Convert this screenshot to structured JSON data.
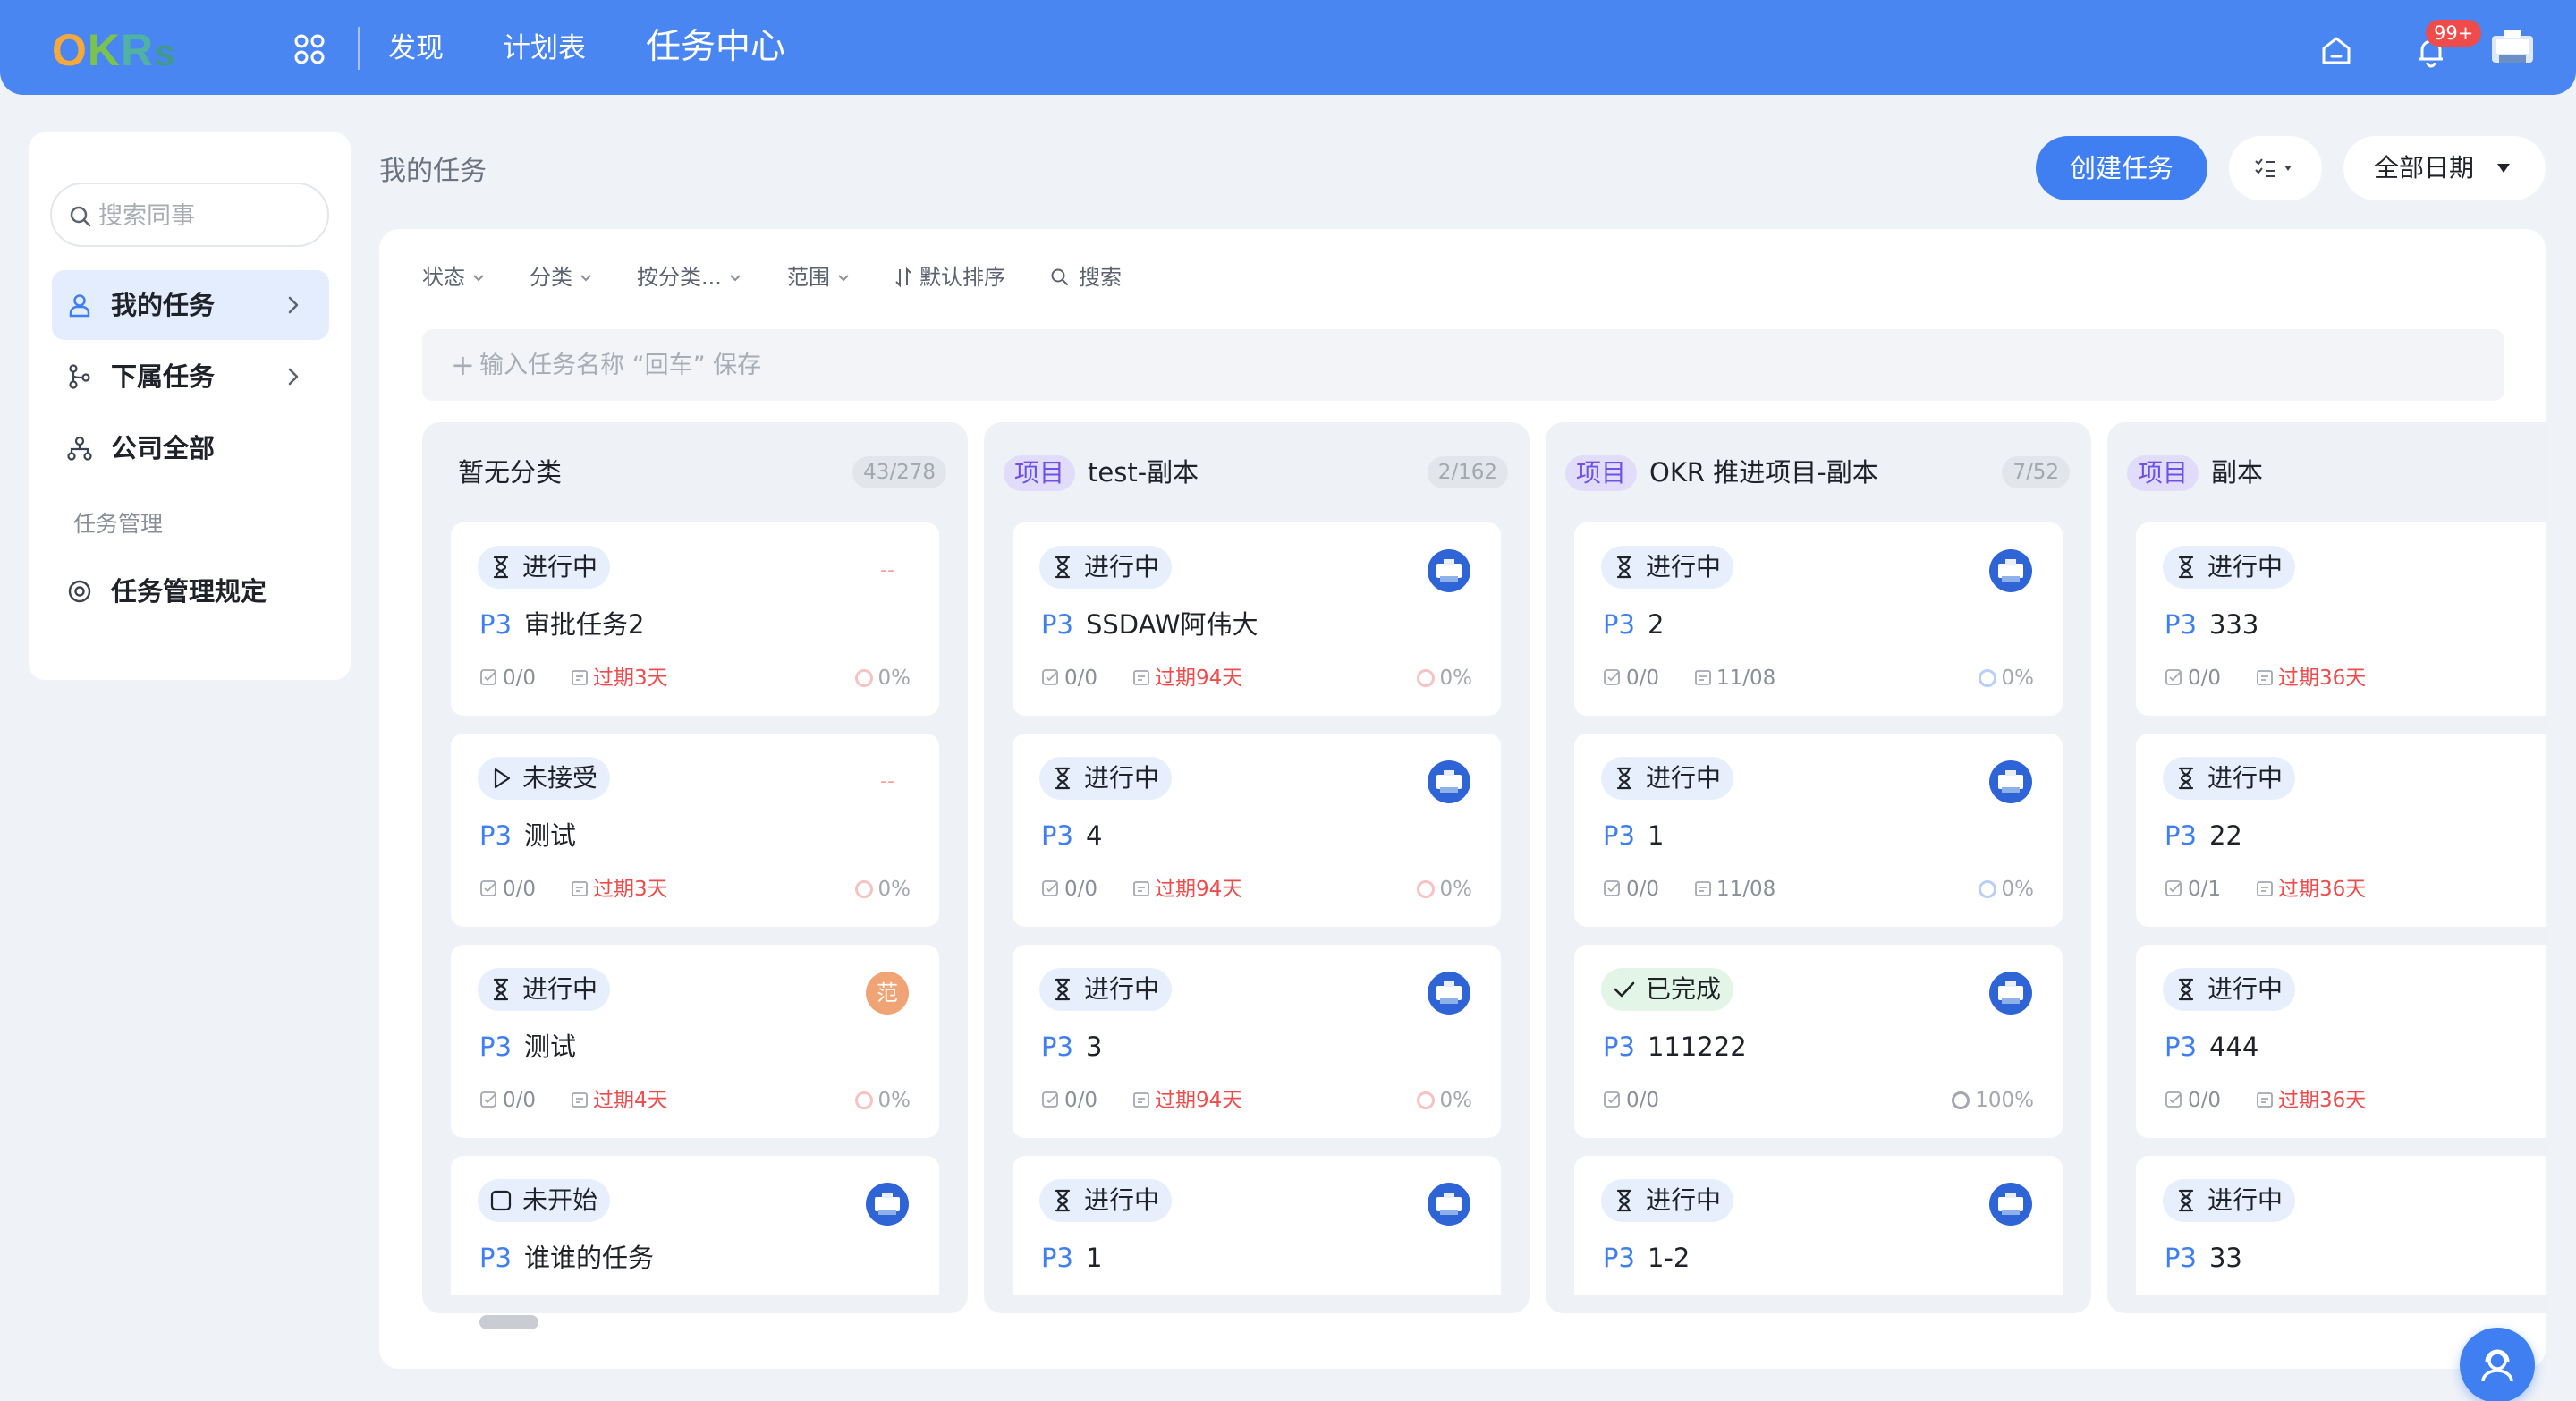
{
  "topbar": {
    "logo": {
      "o": "O",
      "k": "K",
      "r": "R",
      "s": "s"
    },
    "nav": [
      "发现",
      "计划表",
      "任务中心"
    ],
    "notification_count": "99+"
  },
  "sidebar": {
    "search_placeholder": "搜索同事",
    "items": [
      "我的任务",
      "下属任务",
      "公司全部"
    ],
    "section_label": "任务管理",
    "section_items": [
      "任务管理规定"
    ]
  },
  "main": {
    "title": "我的任务",
    "create_button": "创建任务",
    "date_filter": "全部日期",
    "filters": [
      "状态",
      "分类",
      "按分类...",
      "范围",
      "默认排序",
      "搜索"
    ],
    "quick_add_placeholder": "输入任务名称 “回车” 保存",
    "quick_add_plus": "+"
  },
  "columns": [
    {
      "tag": "",
      "name": "暂无分类",
      "count": "43/278",
      "cards": [
        {
          "status": "进行中",
          "priority": "P3",
          "title": "审批任务2",
          "subtasks": "0/0",
          "due": "过期3天",
          "progress": "0%",
          "assignee": "--"
        },
        {
          "status": "未接受",
          "priority": "P3",
          "title": "测试",
          "subtasks": "0/0",
          "due": "过期3天",
          "progress": "0%",
          "assignee": "--"
        },
        {
          "status": "进行中",
          "priority": "P3",
          "title": "测试",
          "subtasks": "0/0",
          "due": "过期4天",
          "progress": "0%",
          "assignee": "范"
        },
        {
          "status": "未开始",
          "priority": "P3",
          "title": "谁谁的任务"
        }
      ]
    },
    {
      "tag": "项目",
      "name": "test-副本",
      "count": "2/162",
      "cards": [
        {
          "status": "进行中",
          "priority": "P3",
          "title": "SSDAW阿伟大",
          "subtasks": "0/0",
          "due": "过期94天",
          "progress": "0%"
        },
        {
          "status": "进行中",
          "priority": "P3",
          "title": "4",
          "subtasks": "0/0",
          "due": "过期94天",
          "progress": "0%"
        },
        {
          "status": "进行中",
          "priority": "P3",
          "title": "3",
          "subtasks": "0/0",
          "due": "过期94天",
          "progress": "0%"
        },
        {
          "status": "进行中",
          "priority": "P3",
          "title": "1"
        }
      ]
    },
    {
      "tag": "项目",
      "name": "OKR 推进项目-副本",
      "count": "7/52",
      "cards": [
        {
          "status": "进行中",
          "priority": "P3",
          "title": "2",
          "subtasks": "0/0",
          "due": "11/08",
          "progress": "0%"
        },
        {
          "status": "进行中",
          "priority": "P3",
          "title": "1",
          "subtasks": "0/0",
          "due": "11/08",
          "progress": "0%"
        },
        {
          "status": "已完成",
          "priority": "P3",
          "title": "111222",
          "subtasks": "0/0",
          "due": "",
          "progress": "100%"
        },
        {
          "status": "进行中",
          "priority": "P3",
          "title": "1-2"
        }
      ]
    },
    {
      "tag": "项目",
      "name": "副本",
      "count": "",
      "cards": [
        {
          "status": "进行中",
          "priority": "P3",
          "title": "333",
          "subtasks": "0/0",
          "due": "过期36天"
        },
        {
          "status": "进行中",
          "priority": "P3",
          "title": "22",
          "subtasks": "0/1",
          "due": "过期36天"
        },
        {
          "status": "进行中",
          "priority": "P3",
          "title": "444",
          "subtasks": "0/0",
          "due": "过期36天"
        },
        {
          "status": "进行中",
          "priority": "P3",
          "title": "33"
        }
      ]
    }
  ],
  "colors": {
    "primary": "#3f7ff1",
    "topbar": "#4a86f2",
    "overdue": "#ee4c4c",
    "project_tag": "#6f52e5",
    "done_bg": "#e2f5e6"
  }
}
